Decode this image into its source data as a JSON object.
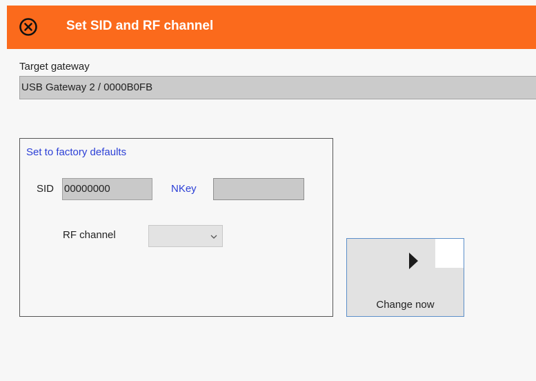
{
  "header": {
    "title": "Set SID and RF channel",
    "close_icon": "close-circle-icon",
    "accent_color": "#fb6a1c"
  },
  "target": {
    "label": "Target gateway",
    "value": "USB Gateway 2 / 0000B0FB"
  },
  "group": {
    "factory_link": "Set to factory defaults",
    "sid_label": "SID",
    "sid_value": "00000000",
    "nkey_label": "NKey",
    "nkey_value": "",
    "rf_label": "RF channel",
    "rf_value": "",
    "rf_icon": "chevron-down-icon"
  },
  "change_button": {
    "label": "Change now",
    "icon": "play-icon"
  },
  "colors": {
    "link": "#2b3fd6",
    "field_bg": "#c9c9c9",
    "button_border": "#5b8ec9"
  }
}
